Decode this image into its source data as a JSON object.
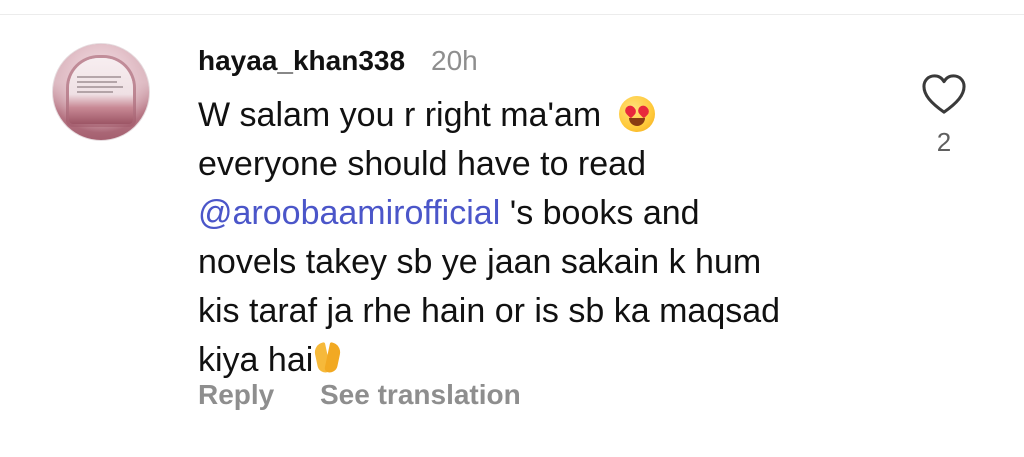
{
  "comment": {
    "username": "hayaa_khan338",
    "timestamp": "20h",
    "lines": [
      "W salam you r right ma'am",
      "everyone should have to read",
      "'s books and",
      "novels takey sb ye jaan sakain k hum",
      "kis taraf ja rhe hain or is sb ka maqsad",
      "kiya hai"
    ],
    "mention": {
      "icon": "@",
      "handle": "aroobaamirofficial"
    },
    "emojis": [
      "heart-eyes-emoji",
      "folded-hands-emoji"
    ],
    "actions": {
      "reply_label": "Reply",
      "translate_label": "See translation"
    },
    "likes": {
      "count": "2",
      "icon": "heart-outline-icon"
    }
  },
  "colors": {
    "mention": "#4b56c9",
    "muted": "#8e8e8e",
    "text": "#111111"
  }
}
